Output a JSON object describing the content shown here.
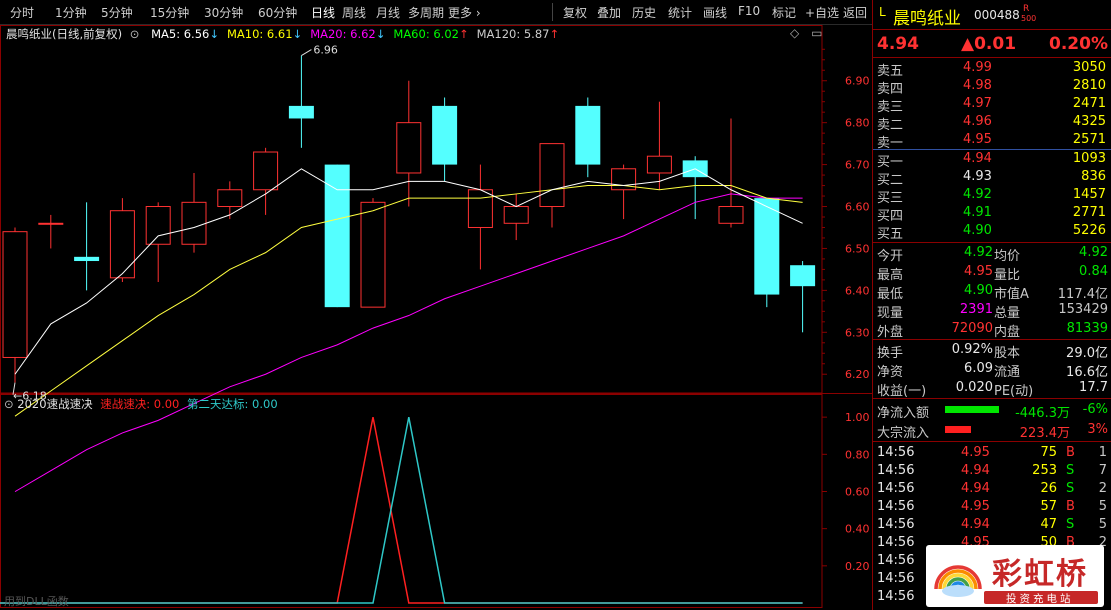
{
  "toolbar": {
    "periods": [
      "分时",
      "1分钟",
      "5分钟",
      "15分钟",
      "30分钟",
      "60分钟",
      "日线",
      "周线",
      "月线",
      "多周期",
      "更多"
    ],
    "active_period": "日线",
    "more_arrow": "›",
    "tools": [
      "复权",
      "叠加",
      "历史",
      "统计",
      "画线",
      "F10",
      "标记",
      "+自选",
      "返回"
    ]
  },
  "main_chart": {
    "title": "晨鸣纸业(日线,前复权)",
    "ma_legend": [
      {
        "label": "MA5: 6.56",
        "arrow": "↓",
        "color": "#ffffff"
      },
      {
        "label": "MA10: 6.61",
        "arrow": "↓",
        "color": "#ffff00"
      },
      {
        "label": "MA20: 6.62",
        "arrow": "↓",
        "color": "#ff00ff"
      },
      {
        "label": "MA60: 6.02",
        "arrow": "↑",
        "color": "#00ff00"
      },
      {
        "label": "MA120: 5.87",
        "arrow": "↑",
        "color": "#cccccc"
      }
    ],
    "high_label": "6.96",
    "low_label": "6.18",
    "controls": [
      "◇",
      "▭"
    ]
  },
  "indicator_chart": {
    "title": "2020速战速决",
    "line1": "速战速决: 0.00",
    "line2": "第二天达标: 0.00",
    "footer": "用到DLL函数"
  },
  "chart_data": [
    {
      "type": "candlestick",
      "title": "",
      "y_axis": [
        6.2,
        6.3,
        6.4,
        6.5,
        6.6,
        6.7,
        6.8,
        6.9
      ],
      "ylim": [
        6.16,
        6.99
      ],
      "candles": [
        {
          "o": 6.24,
          "c": 6.54,
          "h": 6.55,
          "l": 6.18
        },
        {
          "o": 6.56,
          "c": 6.56,
          "h": 6.58,
          "l": 6.5
        },
        {
          "o": 6.48,
          "c": 6.47,
          "h": 6.61,
          "l": 6.4
        },
        {
          "o": 6.43,
          "c": 6.59,
          "h": 6.62,
          "l": 6.42
        },
        {
          "o": 6.51,
          "c": 6.6,
          "h": 6.61,
          "l": 6.42
        },
        {
          "o": 6.51,
          "c": 6.61,
          "h": 6.68,
          "l": 6.49
        },
        {
          "o": 6.6,
          "c": 6.64,
          "h": 6.66,
          "l": 6.57
        },
        {
          "o": 6.64,
          "c": 6.73,
          "h": 6.74,
          "l": 6.58
        },
        {
          "o": 6.84,
          "c": 6.81,
          "h": 6.96,
          "l": 6.74
        },
        {
          "o": 6.7,
          "c": 6.36,
          "h": 6.7,
          "l": 6.36
        },
        {
          "o": 6.36,
          "c": 6.61,
          "h": 6.62,
          "l": 6.36
        },
        {
          "o": 6.68,
          "c": 6.8,
          "h": 6.9,
          "l": 6.6
        },
        {
          "o": 6.84,
          "c": 6.7,
          "h": 6.86,
          "l": 6.66
        },
        {
          "o": 6.55,
          "c": 6.64,
          "h": 6.7,
          "l": 6.45
        },
        {
          "o": 6.56,
          "c": 6.6,
          "h": 6.63,
          "l": 6.52
        },
        {
          "o": 6.6,
          "c": 6.75,
          "h": 6.75,
          "l": 6.55
        },
        {
          "o": 6.84,
          "c": 6.7,
          "h": 6.86,
          "l": 6.67
        },
        {
          "o": 6.64,
          "c": 6.69,
          "h": 6.7,
          "l": 6.57
        },
        {
          "o": 6.68,
          "c": 6.72,
          "h": 6.85,
          "l": 6.64
        },
        {
          "o": 6.71,
          "c": 6.67,
          "h": 6.72,
          "l": 6.57
        },
        {
          "o": 6.56,
          "c": 6.6,
          "h": 6.81,
          "l": 6.55
        },
        {
          "o": 6.62,
          "c": 6.39,
          "h": 6.62,
          "l": 6.36
        },
        {
          "o": 6.46,
          "c": 6.41,
          "h": 6.47,
          "l": 6.3
        }
      ],
      "ma5": [
        6.2,
        6.32,
        6.37,
        6.44,
        6.53,
        6.55,
        6.58,
        6.63,
        6.69,
        6.64,
        6.64,
        6.66,
        6.66,
        6.64,
        6.6,
        6.64,
        6.66,
        6.65,
        6.66,
        6.69,
        6.64,
        6.6,
        6.56
      ],
      "ma10": [
        6.1,
        6.16,
        6.22,
        6.28,
        6.34,
        6.39,
        6.45,
        6.49,
        6.55,
        6.57,
        6.59,
        6.62,
        6.62,
        6.62,
        6.63,
        6.64,
        6.65,
        6.65,
        6.64,
        6.65,
        6.65,
        6.62,
        6.61
      ],
      "ma20": [
        5.92,
        5.97,
        6.02,
        6.06,
        6.09,
        6.13,
        6.17,
        6.2,
        6.24,
        6.27,
        6.31,
        6.34,
        6.38,
        6.41,
        6.44,
        6.47,
        6.5,
        6.53,
        6.57,
        6.61,
        6.63,
        6.62,
        6.62
      ]
    },
    {
      "type": "line",
      "title": "",
      "y_axis": [
        0.2,
        0.4,
        0.6,
        0.8,
        1.0
      ],
      "ylim": [
        0,
        1.06
      ],
      "series": [
        {
          "name": "速战速决",
          "color": "#ff2020",
          "values": [
            0,
            0,
            0,
            0,
            0,
            0,
            0,
            0,
            0,
            0,
            1,
            0,
            0,
            0,
            0,
            0,
            0,
            0,
            0,
            0,
            0,
            0,
            0
          ]
        },
        {
          "name": "第二天达标",
          "color": "#2ec8c8",
          "values": [
            0,
            0,
            0,
            0,
            0,
            0,
            0,
            0,
            0,
            0,
            0,
            1,
            0,
            0,
            0,
            0,
            0,
            0,
            0,
            0,
            0,
            0,
            0
          ]
        }
      ]
    }
  ],
  "quote": {
    "prefix": "L",
    "name": "晨鸣纸业",
    "code": "000488",
    "badge_top": "R",
    "badge_bot": "500",
    "price": "4.94",
    "change": "▲0.01",
    "pct": "0.20%",
    "asks": [
      {
        "label": "卖五",
        "price": "4.99",
        "vol": "3050"
      },
      {
        "label": "卖四",
        "price": "4.98",
        "vol": "2810"
      },
      {
        "label": "卖三",
        "price": "4.97",
        "vol": "2471"
      },
      {
        "label": "卖二",
        "price": "4.96",
        "vol": "4325"
      },
      {
        "label": "卖一",
        "price": "4.95",
        "vol": "2571"
      }
    ],
    "bids": [
      {
        "label": "买一",
        "price": "4.94",
        "vol": "1093",
        "pc": "red"
      },
      {
        "label": "买二",
        "price": "4.93",
        "vol": "836",
        "pc": "wht"
      },
      {
        "label": "买三",
        "price": "4.92",
        "vol": "1457",
        "pc": "grn"
      },
      {
        "label": "买四",
        "price": "4.91",
        "vol": "2771",
        "pc": "grn"
      },
      {
        "label": "买五",
        "price": "4.90",
        "vol": "5226",
        "pc": "grn"
      }
    ],
    "stats": [
      {
        "l1": "今开",
        "v1": "4.92",
        "c1": "grn",
        "l2": "均价",
        "v2": "4.92",
        "c2": "grn"
      },
      {
        "l1": "最高",
        "v1": "4.95",
        "c1": "red",
        "l2": "量比",
        "v2": "0.84",
        "c2": "grn"
      },
      {
        "l1": "最低",
        "v1": "4.90",
        "c1": "grn",
        "l2": "市值A",
        "v2": "117.4亿",
        "c2": "gry"
      },
      {
        "l1": "现量",
        "v1": "2391",
        "c1": "mag",
        "l2": "总量",
        "v2": "153429",
        "c2": "gry"
      },
      {
        "l1": "外盘",
        "v1": "72090",
        "c1": "red",
        "l2": "内盘",
        "v2": "81339",
        "c2": "grn"
      }
    ],
    "fund": [
      {
        "l1": "换手",
        "v1": "0.92%",
        "l2": "股本",
        "v2": "29.0亿"
      },
      {
        "l1": "净资",
        "v1": "6.09",
        "l2": "流通",
        "v2": "16.6亿"
      },
      {
        "l1": "收益(一)",
        "v1": "0.020",
        "l2": "PE(动)",
        "v2": "17.7"
      }
    ],
    "flows": [
      {
        "label": "净流入额",
        "value": "-446.3万",
        "pct": "-6%",
        "bar": "#00e600",
        "vc": "grn",
        "pc": "grn"
      },
      {
        "label": "大宗流入",
        "value": "223.4万",
        "pct": "3%",
        "bar": "#ff2020",
        "vc": "red",
        "pc": "red"
      }
    ],
    "ticks": [
      {
        "t": "14:56",
        "p": "4.95",
        "v": "75",
        "s": "B",
        "n": "1"
      },
      {
        "t": "14:56",
        "p": "4.94",
        "v": "253",
        "s": "S",
        "n": "7"
      },
      {
        "t": "14:56",
        "p": "4.94",
        "v": "26",
        "s": "S",
        "n": "2"
      },
      {
        "t": "14:56",
        "p": "4.95",
        "v": "57",
        "s": "B",
        "n": "5"
      },
      {
        "t": "14:56",
        "p": "4.94",
        "v": "47",
        "s": "S",
        "n": "5"
      },
      {
        "t": "14:56",
        "p": "4.95",
        "v": "50",
        "s": "B",
        "n": "2"
      },
      {
        "t": "14:56",
        "p": "",
        "v": "",
        "s": "",
        "n": ""
      },
      {
        "t": "14:56",
        "p": "",
        "v": "",
        "s": "",
        "n": ""
      },
      {
        "t": "14:56",
        "p": "",
        "v": "",
        "s": "",
        "n": ""
      }
    ]
  },
  "logo": {
    "brand": "彩虹桥",
    "sub": "投资充电站"
  }
}
